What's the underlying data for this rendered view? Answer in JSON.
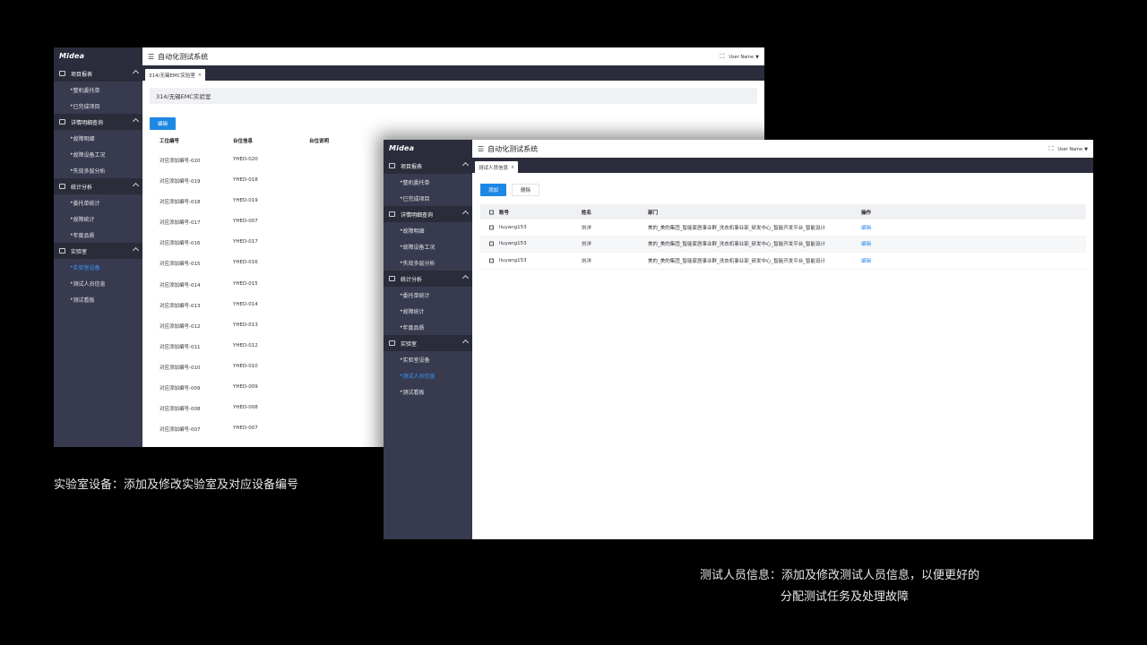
{
  "brand": "Midea",
  "app_title": "自动化测试系统",
  "user_name": "User Name",
  "sidebar": {
    "groups": [
      {
        "label": "项目报表",
        "items": [
          "整机委托单",
          "已完成项目"
        ]
      },
      {
        "label": "详情明细查询",
        "items": [
          "故障明细",
          "故障设备工况",
          "失效多层分析"
        ]
      },
      {
        "label": "统计分析",
        "items": [
          "委托单统计",
          "故障统计",
          "年度品质"
        ]
      },
      {
        "label": "实验室",
        "items": [
          "实验室设备",
          "测试人员信息",
          "测试看板"
        ]
      }
    ]
  },
  "screen_a": {
    "tab_label": "314/无锡EMC实验室",
    "breadcrumb": "314/无锡EMC实验室",
    "edit_button": "编辑",
    "columns": [
      "工位编号",
      "台位信息",
      "台位说明"
    ],
    "rows": [
      [
        "对应添加编号-020",
        "YHED-020"
      ],
      [
        "对应添加编号-019",
        "YHED-018"
      ],
      [
        "对应添加编号-018",
        "YHED-019"
      ],
      [
        "对应添加编号-017",
        "YHED-007"
      ],
      [
        "对应添加编号-016",
        "YHED-017"
      ],
      [
        "对应添加编号-015",
        "YHED-016"
      ],
      [
        "对应添加编号-014",
        "YHED-015"
      ],
      [
        "对应添加编号-013",
        "YHED-014"
      ],
      [
        "对应添加编号-012",
        "YHED-013"
      ],
      [
        "对应添加编号-011",
        "YHED-012"
      ],
      [
        "对应添加编号-010",
        "YHED-010"
      ],
      [
        "对应添加编号-009",
        "YHED-009"
      ],
      [
        "对应添加编号-008",
        "YHED-008"
      ],
      [
        "对应添加编号-007",
        "YHED-007"
      ]
    ]
  },
  "screen_b": {
    "tab_label": "测试人员信息",
    "add_button": "添加",
    "delete_button": "删除",
    "columns": [
      "账号",
      "姓名",
      "部门",
      "操作"
    ],
    "rows": [
      {
        "account": "liuyang153",
        "name": "刘洋",
        "dept": "美的_美的集团_智能家居事业群_洗衣机事业部_研发中心_智能开发平台_智能设计",
        "action": "编辑"
      },
      {
        "account": "liuyang153",
        "name": "刘洋",
        "dept": "美的_美的集团_智能家居事业群_洗衣机事业部_研发中心_智能开发平台_智能设计",
        "action": "编辑"
      },
      {
        "account": "liuyang153",
        "name": "刘洋",
        "dept": "美的_美的集团_智能家居事业群_洗衣机事业部_研发中心_智能开发平台_智能设计",
        "action": "编辑"
      }
    ]
  },
  "captions": {
    "left": "实验室设备：添加及修改实验室及对应设备编号",
    "right_line1": "测试人员信息：添加及修改测试人员信息，以便更好的",
    "right_line2": "分配测试任务及处理故障"
  },
  "colors": {
    "accent": "#1e88e5",
    "sidebar": "#383b4f",
    "sidebar_group": "#2a2c3a",
    "tabbar": "#2b2d3c",
    "active_link": "#3a98ff"
  },
  "active_items": {
    "screen_a": "实验室设备",
    "screen_b": "测试人员信息"
  }
}
